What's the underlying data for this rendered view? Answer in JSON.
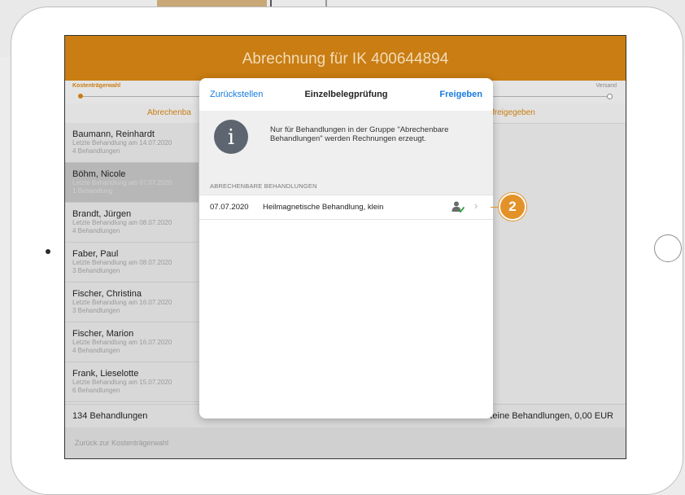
{
  "header": {
    "title": "Abrechnung für IK 400644894"
  },
  "progress": {
    "start_label": "Kostenträgerwahl",
    "end_label": "Versand"
  },
  "tabs": {
    "left": "Abrechenba",
    "right": "freigegeben"
  },
  "patients": [
    {
      "name": "Baumann, Reinhardt",
      "last": "Letzte Behandlung am 14.07.2020",
      "count": "4 Behandlungen"
    },
    {
      "name": "Böhm, Nicole",
      "last": "Letzte Behandlung am 07.07.2020",
      "count": "1 Behandlung"
    },
    {
      "name": "Brandt, Jürgen",
      "last": "Letzte Behandlung am 08.07.2020",
      "count": "4 Behandlungen"
    },
    {
      "name": "Faber, Paul",
      "last": "Letzte Behandlung am 08.07.2020",
      "count": "3 Behandlungen"
    },
    {
      "name": "Fischer, Christina",
      "last": "Letzte Behandlung am 16.07.2020",
      "count": "3 Behandlungen"
    },
    {
      "name": "Fischer, Marion",
      "last": "Letzte Behandlung am 16.07.2020",
      "count": "4 Behandlungen"
    },
    {
      "name": "Frank, Lieselotte",
      "last": "Letzte Behandlung am 15.07.2020",
      "count": "6 Behandlungen"
    }
  ],
  "footer": {
    "total": "134 Behandlungen",
    "summary": "Keine Behandlungen, 0,00 EUR",
    "back": "Zurück zur Kostenträgerwahl"
  },
  "modal": {
    "back_label": "Zurückstellen",
    "title": "Einzelbelegprüfung",
    "confirm_label": "Freigeben",
    "info_icon": "i",
    "info_text": "Nur für Behandlungen in der Gruppe \"Abrechenbare Behandlungen\" werden Rechnungen erzeugt.",
    "section_header": "ABRECHENBARE BEHANDLUNGEN",
    "item": {
      "date": "07.07.2020",
      "treatment": "Heilmagnetische Behandlung, klein"
    }
  },
  "callout": {
    "number": "2"
  },
  "colors": {
    "accent": "#c97d12",
    "link": "#1a7be0",
    "callout": "#e3922a"
  }
}
